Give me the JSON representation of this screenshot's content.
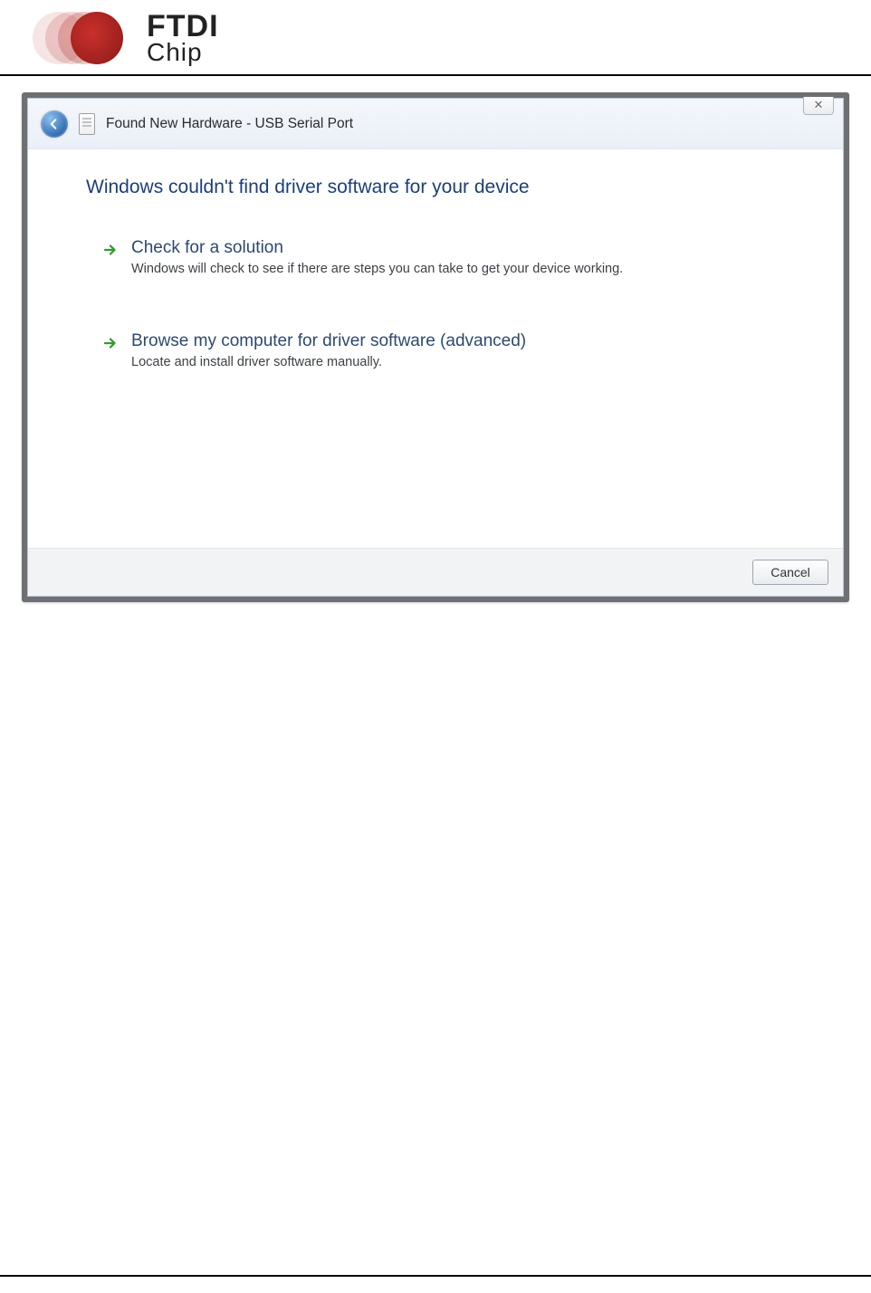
{
  "logo": {
    "line1": "FTDI",
    "line2": "Chip"
  },
  "dialog": {
    "window_title": "Found New Hardware - USB Serial Port",
    "close_glyph": "✕",
    "heading": "Windows couldn't find driver software for your device",
    "options": [
      {
        "title": "Check for a solution",
        "desc": "Windows will check to see if there are steps you can take to get your device working."
      },
      {
        "title": "Browse my computer for driver software (advanced)",
        "desc": "Locate and install driver software manually."
      }
    ],
    "cancel_label": "Cancel"
  }
}
